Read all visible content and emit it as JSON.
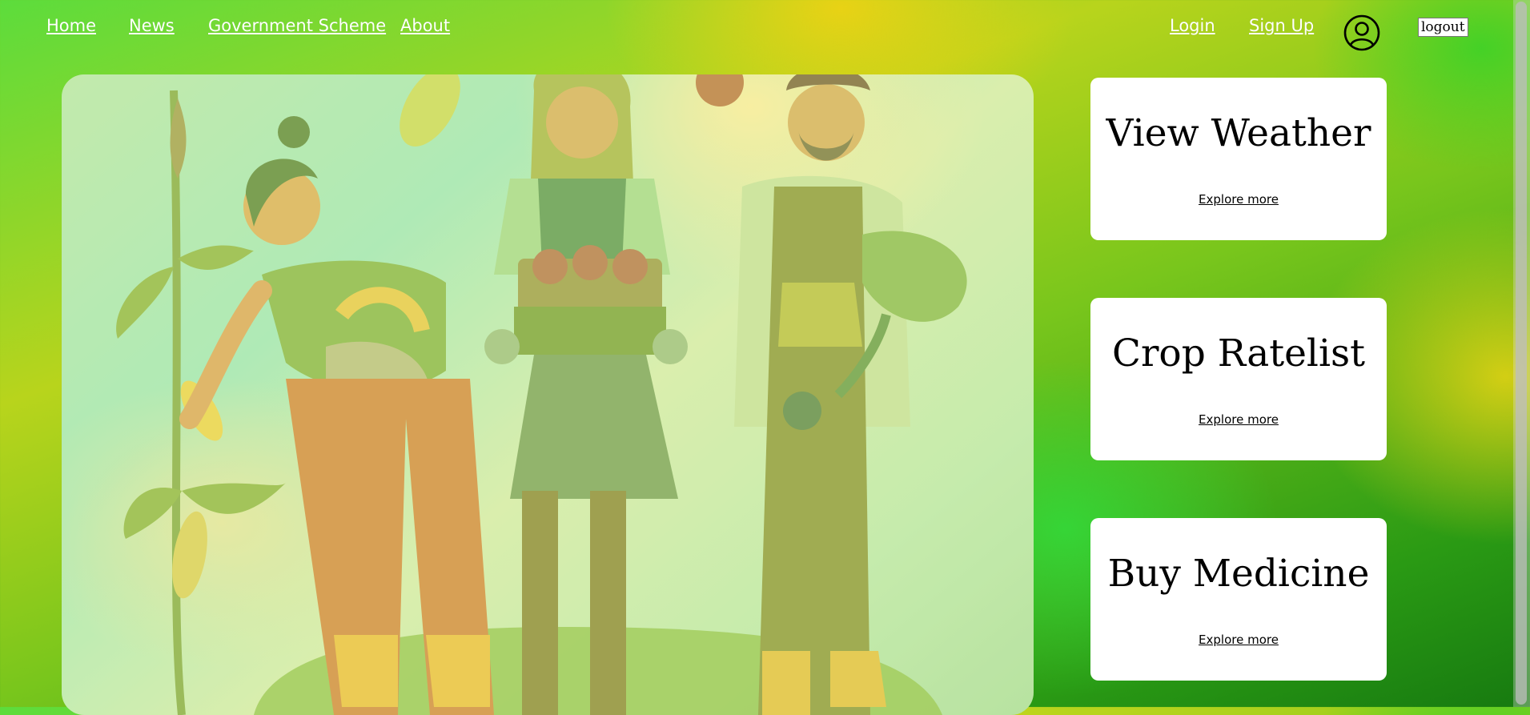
{
  "nav": {
    "home": "Home",
    "news": "News",
    "government_scheme": "Government Scheme",
    "about": "About",
    "login": "Login",
    "signup": "Sign Up",
    "profile_icon": "user-circle-icon",
    "logout": "logout"
  },
  "cards": [
    {
      "title": "View Weather",
      "link": "Explore more"
    },
    {
      "title": "Crop Ratelist",
      "link": "Explore more"
    },
    {
      "title": "Buy Medicine",
      "link": "Explore more"
    }
  ],
  "colors": {
    "page_green": "#8fd62a",
    "page_yellow": "#ecd214",
    "hero_bg": "#b6e69a",
    "card_bg": "#ffffff",
    "nav_text": "#ffffff"
  }
}
